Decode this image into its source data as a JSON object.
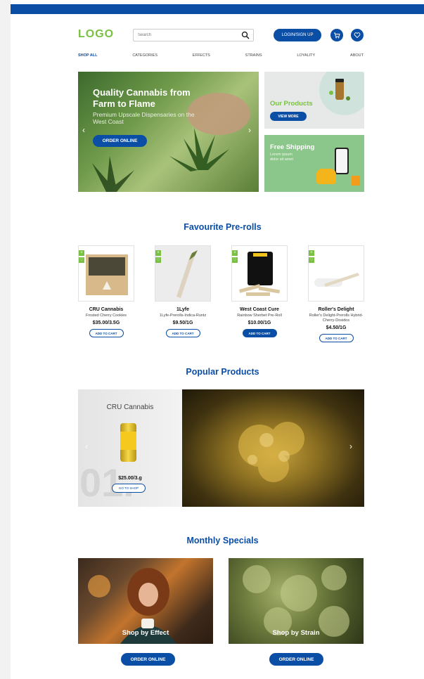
{
  "header": {
    "logo": "LOGO",
    "search_placeholder": "Search",
    "login_label": "LOGIN/SIGN UP"
  },
  "nav": [
    "SHOP ALL",
    "CATEGORIES",
    "EFFECTS",
    "STRAINS",
    "LOYALITY",
    "ABOUT"
  ],
  "hero": {
    "title": "Quality Cannabis from Farm to Flame",
    "subtitle": "Premium Upscale Dispensaries on the West Coast",
    "button": "ORDER ONLINE",
    "prev": "‹",
    "next": "›"
  },
  "promos": {
    "products": {
      "title": "Our Products",
      "button": "VIEW MORE"
    },
    "shipping": {
      "title": "Free Shipping",
      "text": "Lorem ipsum dolor sit amet"
    }
  },
  "prerolls": {
    "title": "Favourite Pre-rolls",
    "items": [
      {
        "name": "CRU Cannabis",
        "desc": "Frosted Cherry Cookies",
        "price": "$35.00/3.5G",
        "button": "ADD TO CART"
      },
      {
        "name": "1Lyfe",
        "desc": "1Lyfe-Prerolls-Indica-Runtz",
        "price": "$9.50/1G",
        "button": "ADD TO CART"
      },
      {
        "name": "West Coast Cure",
        "desc": "Rainbow Sherbet Pre-Roll",
        "price": "$10.00/1G",
        "button": "ADD TO CART"
      },
      {
        "name": "Roller's Delight",
        "desc": "Roller's Delight-Prerolls Hybrid-Cherry-Dosidos",
        "price": "$4.50/1G",
        "button": "ADD TO CART"
      }
    ]
  },
  "popular": {
    "title": "Popular Products",
    "brand": "CRU Cannabis",
    "number": "01.",
    "price": "$25.00/3.g",
    "button": "GO TO SHOP",
    "prev": "‹",
    "next": "›"
  },
  "specials": {
    "title": "Monthly Specials",
    "effect_label": "Shop by Effect",
    "strain_label": "Shop by Strain",
    "button": "ORDER ONLINE"
  },
  "colors": {
    "brand_blue": "#0b4ea6",
    "logo_green": "#7ac143"
  }
}
